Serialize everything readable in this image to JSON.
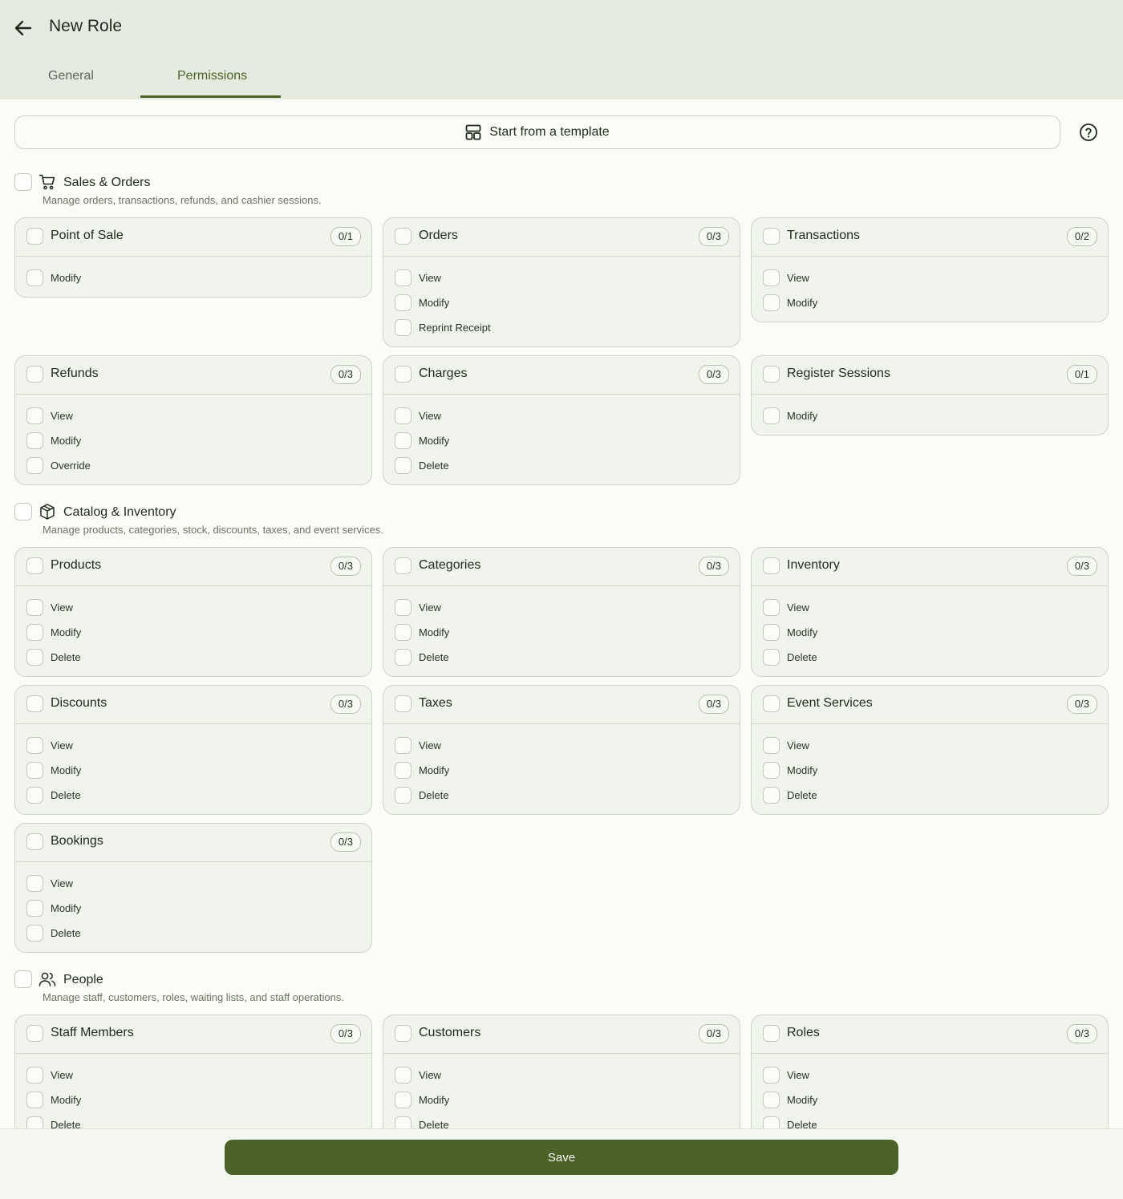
{
  "header": {
    "title": "New Role",
    "tabs": [
      {
        "label": "General",
        "active": false
      },
      {
        "label": "Permissions",
        "active": true
      }
    ]
  },
  "template_button": {
    "label": "Start from a template",
    "icon": "template-icon"
  },
  "help_icon": "question-circle-icon",
  "accent_color": "#4b6229",
  "sections": [
    {
      "title": "Sales & Orders",
      "description": "Manage orders, transactions, refunds, and cashier sessions.",
      "icon": "cart-icon",
      "cards": [
        {
          "title": "Point of Sale",
          "count": "0/1",
          "perms": [
            "Modify"
          ]
        },
        {
          "title": "Orders",
          "count": "0/3",
          "perms": [
            "View",
            "Modify",
            "Reprint Receipt"
          ]
        },
        {
          "title": "Transactions",
          "count": "0/2",
          "perms": [
            "View",
            "Modify"
          ]
        },
        {
          "title": "Refunds",
          "count": "0/3",
          "perms": [
            "View",
            "Modify",
            "Override"
          ]
        },
        {
          "title": "Charges",
          "count": "0/3",
          "perms": [
            "View",
            "Modify",
            "Delete"
          ]
        },
        {
          "title": "Register Sessions",
          "count": "0/1",
          "perms": [
            "Modify"
          ]
        }
      ]
    },
    {
      "title": "Catalog & Inventory",
      "description": "Manage products, categories, stock, discounts, taxes, and event services.",
      "icon": "box-icon",
      "cards": [
        {
          "title": "Products",
          "count": "0/3",
          "perms": [
            "View",
            "Modify",
            "Delete"
          ]
        },
        {
          "title": "Categories",
          "count": "0/3",
          "perms": [
            "View",
            "Modify",
            "Delete"
          ]
        },
        {
          "title": "Inventory",
          "count": "0/3",
          "perms": [
            "View",
            "Modify",
            "Delete"
          ]
        },
        {
          "title": "Discounts",
          "count": "0/3",
          "perms": [
            "View",
            "Modify",
            "Delete"
          ]
        },
        {
          "title": "Taxes",
          "count": "0/3",
          "perms": [
            "View",
            "Modify",
            "Delete"
          ]
        },
        {
          "title": "Event Services",
          "count": "0/3",
          "perms": [
            "View",
            "Modify",
            "Delete"
          ]
        },
        {
          "title": "Bookings",
          "count": "0/3",
          "perms": [
            "View",
            "Modify",
            "Delete"
          ]
        }
      ]
    },
    {
      "title": "People",
      "description": "Manage staff, customers, roles, waiting lists, and staff operations.",
      "icon": "users-icon",
      "cards": [
        {
          "title": "Staff Members",
          "count": "0/3",
          "perms": [
            "View",
            "Modify",
            "Delete"
          ]
        },
        {
          "title": "Customers",
          "count": "0/3",
          "perms": [
            "View",
            "Modify",
            "Delete"
          ]
        },
        {
          "title": "Roles",
          "count": "0/3",
          "perms": [
            "View",
            "Modify",
            "Delete"
          ]
        }
      ]
    }
  ],
  "footer": {
    "save_label": "Save"
  }
}
